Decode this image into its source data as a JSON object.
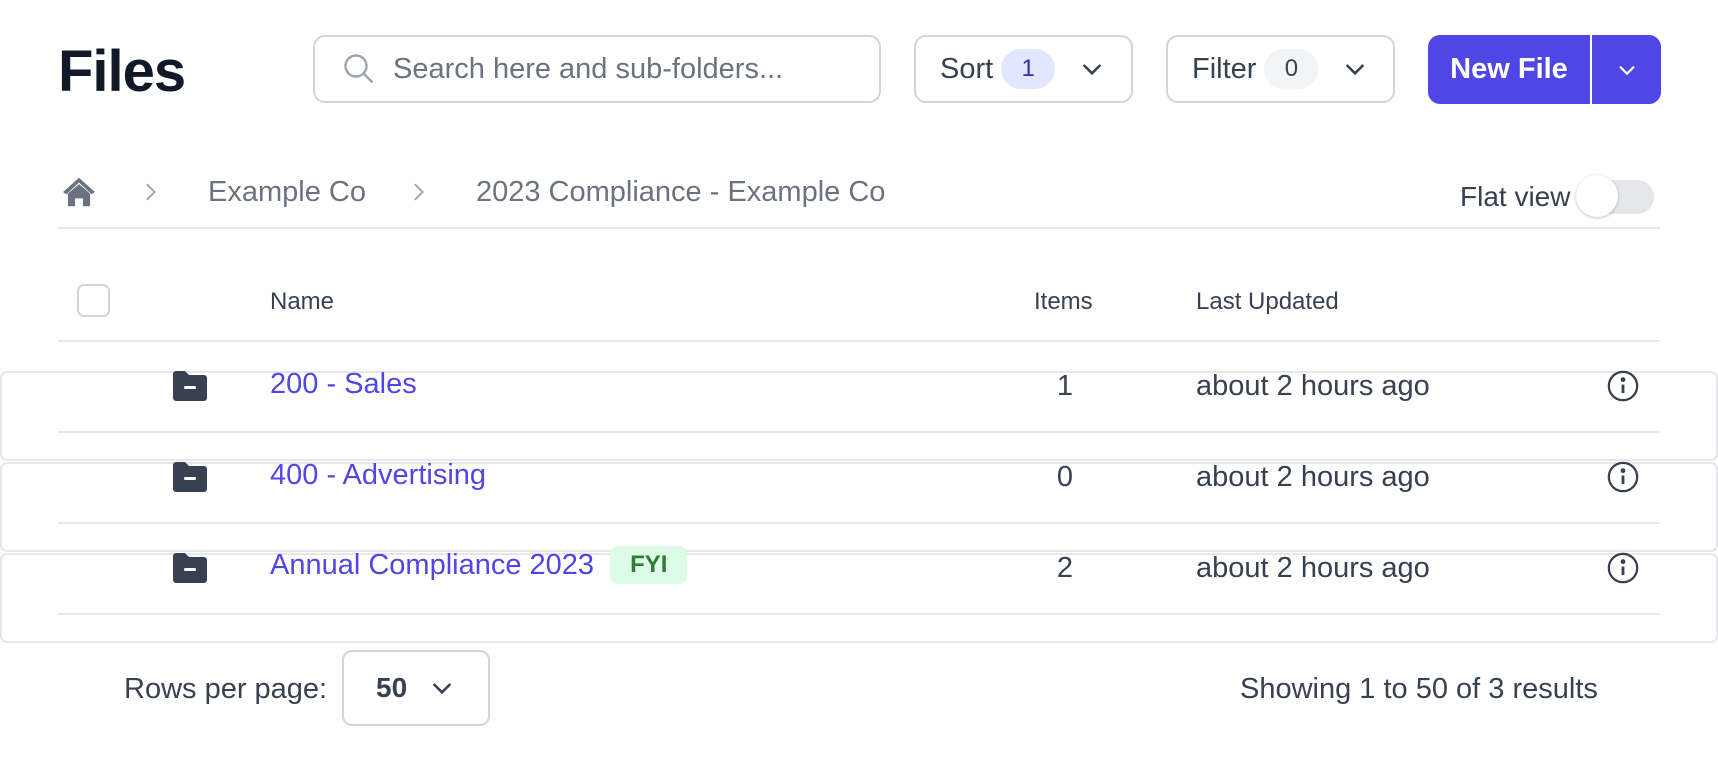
{
  "header": {
    "title": "Files",
    "search": {
      "placeholder": "Search here and sub-folders...",
      "value": "",
      "icon": "search-icon"
    },
    "sort": {
      "label": "Sort",
      "count": "1",
      "icon": "chevron-down-icon"
    },
    "filter": {
      "label": "Filter",
      "count": "0",
      "icon": "chevron-down-icon"
    },
    "new_file": {
      "label": "New File",
      "menu_icon": "chevron-down-icon"
    },
    "colors": {
      "primary": "#4f46e5",
      "sort_badge_bg": "#e0e7ff",
      "filter_badge_bg": "#f3f4f6"
    }
  },
  "breadcrumb": {
    "home_icon": "home-icon",
    "items": [
      "Example Co",
      "2023 Compliance - Example Co"
    ]
  },
  "flat_view": {
    "label": "Flat view",
    "enabled": false
  },
  "table": {
    "columns": [
      "Name",
      "Items",
      "Last Updated"
    ],
    "rows": [
      {
        "name": "200 - Sales",
        "tag": "",
        "items": "1",
        "updated": "about 2 hours ago",
        "icon": "folder-icon"
      },
      {
        "name": "400 - Advertising",
        "tag": "",
        "items": "0",
        "updated": "about 2 hours ago",
        "icon": "folder-icon"
      },
      {
        "name": "Annual Compliance 2023",
        "tag": "FYI",
        "items": "2",
        "updated": "about 2 hours ago",
        "icon": "folder-icon"
      }
    ],
    "tag_colors": {
      "fyi_bg": "#dcfce7",
      "fyi_text": "#2e7d32"
    }
  },
  "pagination": {
    "rows_per_page_label": "Rows per page:",
    "rows_per_page": "50",
    "summary": "Showing 1 to 50 of 3 results"
  }
}
